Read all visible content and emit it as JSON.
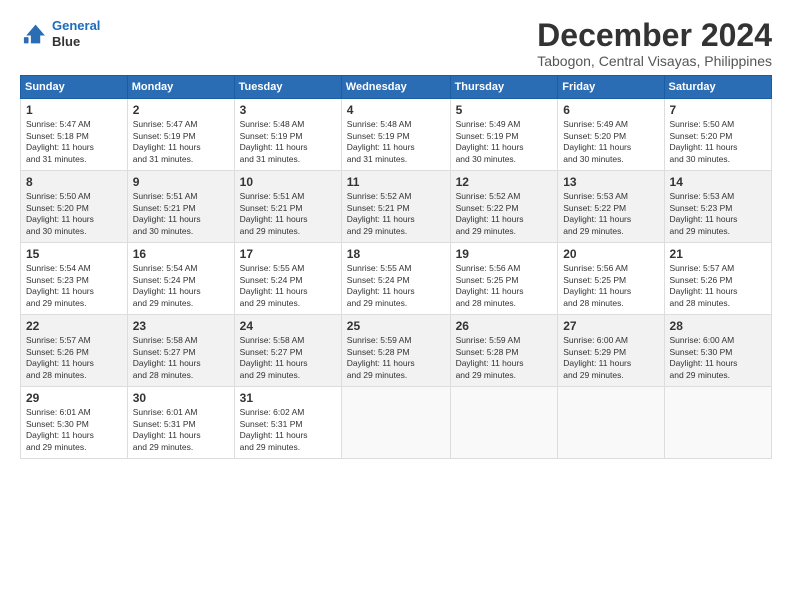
{
  "logo": {
    "line1": "General",
    "line2": "Blue"
  },
  "title": "December 2024",
  "subtitle": "Tabogon, Central Visayas, Philippines",
  "weekdays": [
    "Sunday",
    "Monday",
    "Tuesday",
    "Wednesday",
    "Thursday",
    "Friday",
    "Saturday"
  ],
  "weeks": [
    [
      {
        "day": "1",
        "sunrise": "5:47 AM",
        "sunset": "5:18 PM",
        "daylight": "11 hours and 31 minutes."
      },
      {
        "day": "2",
        "sunrise": "5:47 AM",
        "sunset": "5:19 PM",
        "daylight": "11 hours and 31 minutes."
      },
      {
        "day": "3",
        "sunrise": "5:48 AM",
        "sunset": "5:19 PM",
        "daylight": "11 hours and 31 minutes."
      },
      {
        "day": "4",
        "sunrise": "5:48 AM",
        "sunset": "5:19 PM",
        "daylight": "11 hours and 31 minutes."
      },
      {
        "day": "5",
        "sunrise": "5:49 AM",
        "sunset": "5:19 PM",
        "daylight": "11 hours and 30 minutes."
      },
      {
        "day": "6",
        "sunrise": "5:49 AM",
        "sunset": "5:20 PM",
        "daylight": "11 hours and 30 minutes."
      },
      {
        "day": "7",
        "sunrise": "5:50 AM",
        "sunset": "5:20 PM",
        "daylight": "11 hours and 30 minutes."
      }
    ],
    [
      {
        "day": "8",
        "sunrise": "5:50 AM",
        "sunset": "5:20 PM",
        "daylight": "11 hours and 30 minutes."
      },
      {
        "day": "9",
        "sunrise": "5:51 AM",
        "sunset": "5:21 PM",
        "daylight": "11 hours and 30 minutes."
      },
      {
        "day": "10",
        "sunrise": "5:51 AM",
        "sunset": "5:21 PM",
        "daylight": "11 hours and 29 minutes."
      },
      {
        "day": "11",
        "sunrise": "5:52 AM",
        "sunset": "5:21 PM",
        "daylight": "11 hours and 29 minutes."
      },
      {
        "day": "12",
        "sunrise": "5:52 AM",
        "sunset": "5:22 PM",
        "daylight": "11 hours and 29 minutes."
      },
      {
        "day": "13",
        "sunrise": "5:53 AM",
        "sunset": "5:22 PM",
        "daylight": "11 hours and 29 minutes."
      },
      {
        "day": "14",
        "sunrise": "5:53 AM",
        "sunset": "5:23 PM",
        "daylight": "11 hours and 29 minutes."
      }
    ],
    [
      {
        "day": "15",
        "sunrise": "5:54 AM",
        "sunset": "5:23 PM",
        "daylight": "11 hours and 29 minutes."
      },
      {
        "day": "16",
        "sunrise": "5:54 AM",
        "sunset": "5:24 PM",
        "daylight": "11 hours and 29 minutes."
      },
      {
        "day": "17",
        "sunrise": "5:55 AM",
        "sunset": "5:24 PM",
        "daylight": "11 hours and 29 minutes."
      },
      {
        "day": "18",
        "sunrise": "5:55 AM",
        "sunset": "5:24 PM",
        "daylight": "11 hours and 29 minutes."
      },
      {
        "day": "19",
        "sunrise": "5:56 AM",
        "sunset": "5:25 PM",
        "daylight": "11 hours and 28 minutes."
      },
      {
        "day": "20",
        "sunrise": "5:56 AM",
        "sunset": "5:25 PM",
        "daylight": "11 hours and 28 minutes."
      },
      {
        "day": "21",
        "sunrise": "5:57 AM",
        "sunset": "5:26 PM",
        "daylight": "11 hours and 28 minutes."
      }
    ],
    [
      {
        "day": "22",
        "sunrise": "5:57 AM",
        "sunset": "5:26 PM",
        "daylight": "11 hours and 28 minutes."
      },
      {
        "day": "23",
        "sunrise": "5:58 AM",
        "sunset": "5:27 PM",
        "daylight": "11 hours and 28 minutes."
      },
      {
        "day": "24",
        "sunrise": "5:58 AM",
        "sunset": "5:27 PM",
        "daylight": "11 hours and 29 minutes."
      },
      {
        "day": "25",
        "sunrise": "5:59 AM",
        "sunset": "5:28 PM",
        "daylight": "11 hours and 29 minutes."
      },
      {
        "day": "26",
        "sunrise": "5:59 AM",
        "sunset": "5:28 PM",
        "daylight": "11 hours and 29 minutes."
      },
      {
        "day": "27",
        "sunrise": "6:00 AM",
        "sunset": "5:29 PM",
        "daylight": "11 hours and 29 minutes."
      },
      {
        "day": "28",
        "sunrise": "6:00 AM",
        "sunset": "5:30 PM",
        "daylight": "11 hours and 29 minutes."
      }
    ],
    [
      {
        "day": "29",
        "sunrise": "6:01 AM",
        "sunset": "5:30 PM",
        "daylight": "11 hours and 29 minutes."
      },
      {
        "day": "30",
        "sunrise": "6:01 AM",
        "sunset": "5:31 PM",
        "daylight": "11 hours and 29 minutes."
      },
      {
        "day": "31",
        "sunrise": "6:02 AM",
        "sunset": "5:31 PM",
        "daylight": "11 hours and 29 minutes."
      },
      null,
      null,
      null,
      null
    ]
  ]
}
